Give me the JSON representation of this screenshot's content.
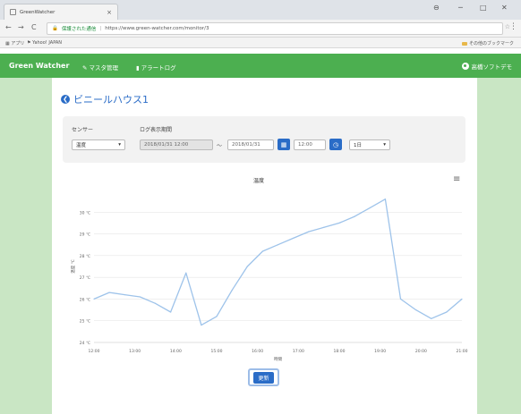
{
  "browser": {
    "tab_title": "GreenWatcher",
    "tab_close": "×",
    "window_controls": [
      "⊖",
      "─",
      "□",
      "✕"
    ],
    "back": "←",
    "forward": "→",
    "reload": "C",
    "secure_label": "保護された通信",
    "url": "https://www.green-watcher.com/monitor/3",
    "bookmarks_apps": "アプリ",
    "bookmarks_item": "Yahoo! JAPAN",
    "bookmarks_other": "その他のブックマーク"
  },
  "nav": {
    "brand": "Green Watcher",
    "links": [
      "マスタ管理",
      "アラートログ"
    ],
    "user": "高橋ソフトデモ"
  },
  "page": {
    "title": "ビニールハウス1",
    "sensor_label": "センサー",
    "sensor_value": "温度",
    "period_label": "ログ表示期間",
    "date_from": "2018/01/31 12:00",
    "tilde": "〜",
    "date_to": "2018/01/31",
    "time_to": "12:00",
    "range_value": "1日",
    "update_button": "更新"
  },
  "chart_data": {
    "type": "line",
    "title": "温度",
    "xlabel": "時間",
    "ylabel": "温度 ℃",
    "x": [
      "12:00",
      "13:00",
      "14:00",
      "15:00",
      "16:00",
      "17:00",
      "18:00",
      "19:00",
      "20:00",
      "21:00",
      "22:00",
      "23:00",
      "00:00",
      "01:00",
      "02:00",
      "03:00",
      "04:00",
      "05:00",
      "06:00",
      "07:00",
      "08:00",
      "09:00",
      "10:00",
      "11:00",
      "12:00"
    ],
    "series": [
      {
        "values": [
          26.0,
          26.3,
          26.2,
          26.1,
          25.8,
          25.4,
          27.2,
          24.8,
          25.2,
          26.4,
          27.5,
          28.2,
          28.5,
          28.8,
          29.1,
          29.3,
          29.5,
          29.8,
          30.2,
          30.6,
          26.0,
          25.5,
          25.1,
          25.4,
          26.0
        ],
        "color": "#9ec3ea"
      }
    ],
    "xticks": [
      "12:00",
      "13:00",
      "14:00",
      "15:00",
      "16:00",
      "17:00",
      "18:00",
      "19:00",
      "20:00",
      "21:00"
    ],
    "yticks": [
      "24 ℃",
      "25 ℃",
      "26 ℃",
      "27 ℃",
      "28 ℃",
      "29 ℃",
      "30 ℃"
    ],
    "ylim": [
      24,
      31
    ],
    "legend": false,
    "grid": true,
    "menu_icon": "≡"
  }
}
